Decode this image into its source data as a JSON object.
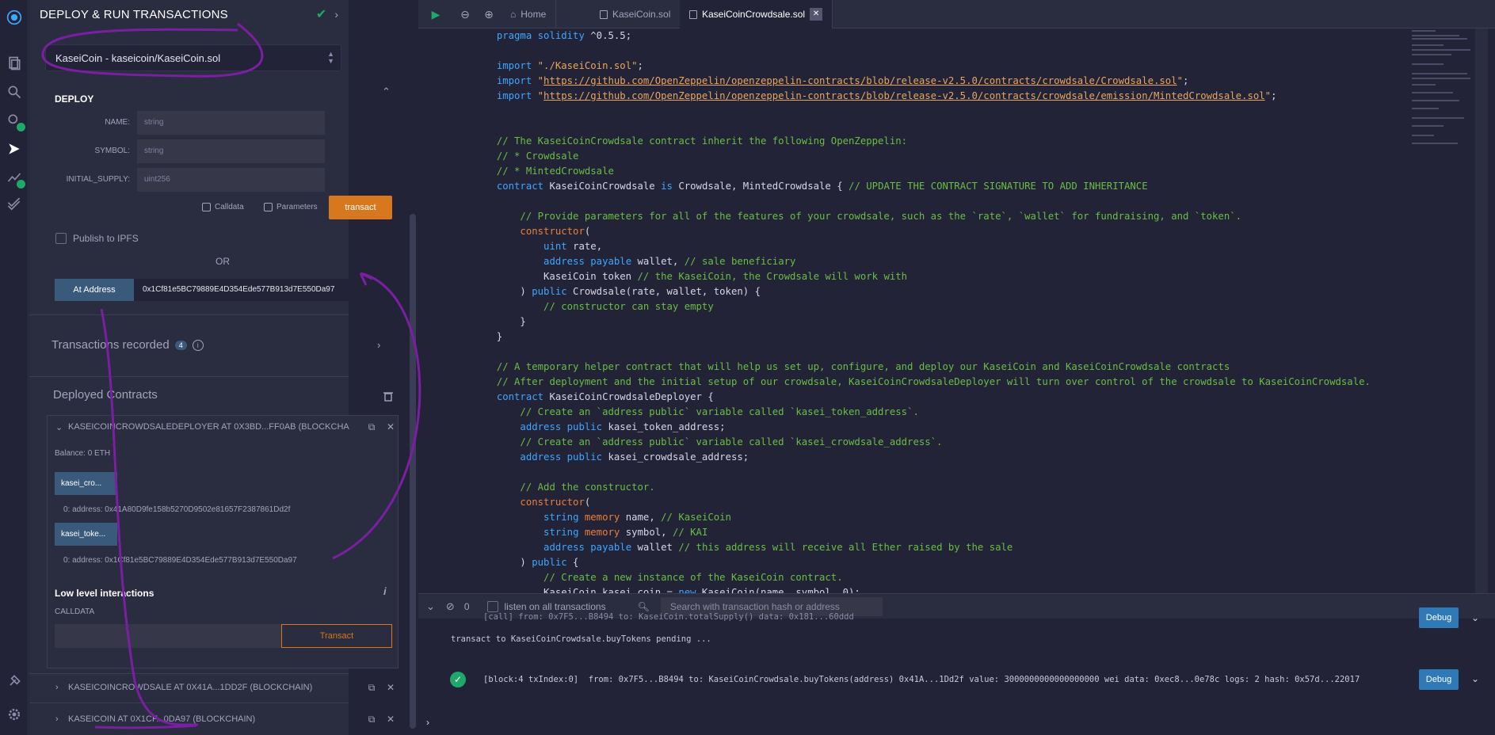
{
  "panel": {
    "title": "DEPLOY & RUN TRANSACTIONS",
    "contract_select": "KaseiCoin - kaseicoin/KaseiCoin.sol",
    "deploy_label": "DEPLOY",
    "fields": [
      {
        "label": "NAME:",
        "placeholder": "string"
      },
      {
        "label": "SYMBOL:",
        "placeholder": "string"
      },
      {
        "label": "INITIAL_SUPPLY:",
        "placeholder": "uint256"
      }
    ],
    "calldata_label": "Calldata",
    "parameters_label": "Parameters",
    "transact_label": "transact",
    "publish_label": "Publish to IPFS",
    "or_label": "OR",
    "at_address_label": "At Address",
    "at_address_value": "0x1Cf81e5BC79889E4D354Ede577B913d7E550Da97",
    "tx_recorded_label": "Transactions recorded",
    "tx_recorded_count": "4",
    "tx_info": "i",
    "deployed_title": "Deployed Contracts",
    "deployed": [
      {
        "name": "KASEICOINCROWDSALEDEPLOYER AT 0X3BD...FF0AB (BLOCKCHA"
      },
      {
        "name": "KASEICOINCROWDSALE AT 0X41A...1DD2F (BLOCKCHAIN)"
      },
      {
        "name": "KASEICOIN AT 0X1CF...0DA97 (BLOCKCHAIN)"
      }
    ],
    "balance": "Balance: 0 ETH",
    "functions": [
      {
        "label": "kasei_cro...",
        "output": "0: address: 0x41A80D9fe158b5270D9502e81657F2387861Dd2f"
      },
      {
        "label": "kasei_toke...",
        "output": "0: address: 0x1Cf81e5BC79889E4D354Ede577B913d7E550Da97"
      }
    ],
    "low_level_label": "Low level interactions",
    "low_level_info": "i",
    "calldata_caps": "CALLDATA",
    "transact_btn2": "Transact"
  },
  "tabs": [
    {
      "label": "Home"
    },
    {
      "label": "KaseiCoin.sol"
    },
    {
      "label": "KaseiCoinCrowdsale.sol"
    }
  ],
  "terminal": {
    "count": "0",
    "listen_label": "listen on all transactions",
    "search_placeholder": "Search with transaction hash or address",
    "line0": "[call] from: 0x7F5...B8494 to: KaseiCoin.totalSupply() data: 0x181...60ddd",
    "line1": "transact to KaseiCoinCrowdsale.buyTokens pending ...",
    "line2": "[block:4 txIndex:0]  from: 0x7F5...B8494 to: KaseiCoinCrowdsale.buyTokens(address) 0x41A...1Dd2f value: 3000000000000000000 wei data: 0xec8...0e78c logs: 2 hash: 0x57d...22017",
    "debug_label": "Debug"
  },
  "colors": {
    "accent_orange": "#d7771e",
    "accent_blue": "#3a5a7c",
    "success_green": "#1ea86a",
    "annotation_purple": "#7b1fa2"
  }
}
